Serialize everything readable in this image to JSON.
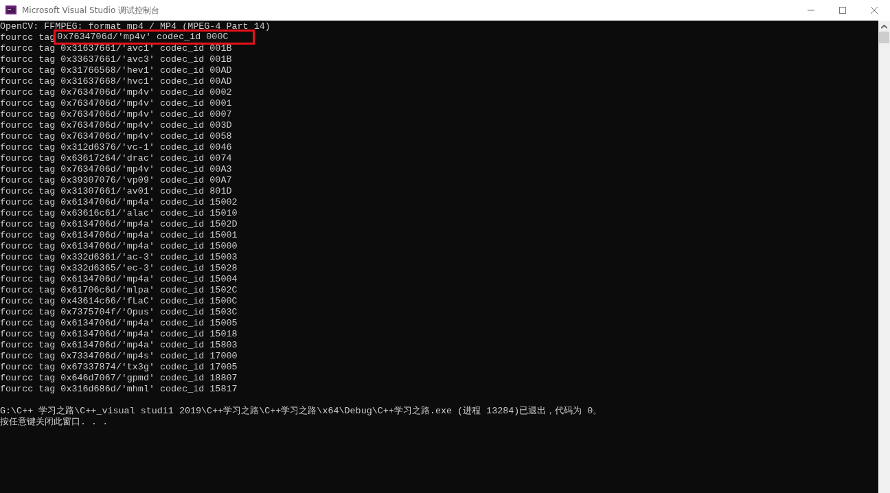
{
  "window": {
    "title": "Microsoft Visual Studio 调试控制台"
  },
  "console": {
    "header": "OpenCV: FFMPEG: format mp4 / MP4 (MPEG-4 Part 14)",
    "lines": [
      {
        "label": "fourcc tag",
        "value": "0x7634706d/'mp4v' codec_id 000C",
        "highlighted": true
      },
      {
        "label": "fourcc tag",
        "value": "0x31637661/'avc1' codec_id 001B",
        "highlighted": false
      },
      {
        "label": "fourcc tag",
        "value": "0x33637661/'avc3' codec_id 001B",
        "highlighted": false
      },
      {
        "label": "fourcc tag",
        "value": "0x31766568/'hev1' codec_id 00AD",
        "highlighted": false
      },
      {
        "label": "fourcc tag",
        "value": "0x31637668/'hvc1' codec_id 00AD",
        "highlighted": false
      },
      {
        "label": "fourcc tag",
        "value": "0x7634706d/'mp4v' codec_id 0002",
        "highlighted": false
      },
      {
        "label": "fourcc tag",
        "value": "0x7634706d/'mp4v' codec_id 0001",
        "highlighted": false
      },
      {
        "label": "fourcc tag",
        "value": "0x7634706d/'mp4v' codec_id 0007",
        "highlighted": false
      },
      {
        "label": "fourcc tag",
        "value": "0x7634706d/'mp4v' codec_id 003D",
        "highlighted": false
      },
      {
        "label": "fourcc tag",
        "value": "0x7634706d/'mp4v' codec_id 0058",
        "highlighted": false
      },
      {
        "label": "fourcc tag",
        "value": "0x312d6376/'vc-1' codec_id 0046",
        "highlighted": false
      },
      {
        "label": "fourcc tag",
        "value": "0x63617264/'drac' codec_id 0074",
        "highlighted": false
      },
      {
        "label": "fourcc tag",
        "value": "0x7634706d/'mp4v' codec_id 00A3",
        "highlighted": false
      },
      {
        "label": "fourcc tag",
        "value": "0x39307076/'vp09' codec_id 00A7",
        "highlighted": false
      },
      {
        "label": "fourcc tag",
        "value": "0x31307661/'av01' codec_id 801D",
        "highlighted": false
      },
      {
        "label": "fourcc tag",
        "value": "0x6134706d/'mp4a' codec_id 15002",
        "highlighted": false
      },
      {
        "label": "fourcc tag",
        "value": "0x63616c61/'alac' codec_id 15010",
        "highlighted": false
      },
      {
        "label": "fourcc tag",
        "value": "0x6134706d/'mp4a' codec_id 1502D",
        "highlighted": false
      },
      {
        "label": "fourcc tag",
        "value": "0x6134706d/'mp4a' codec_id 15001",
        "highlighted": false
      },
      {
        "label": "fourcc tag",
        "value": "0x6134706d/'mp4a' codec_id 15000",
        "highlighted": false
      },
      {
        "label": "fourcc tag",
        "value": "0x332d6361/'ac-3' codec_id 15003",
        "highlighted": false
      },
      {
        "label": "fourcc tag",
        "value": "0x332d6365/'ec-3' codec_id 15028",
        "highlighted": false
      },
      {
        "label": "fourcc tag",
        "value": "0x6134706d/'mp4a' codec_id 15004",
        "highlighted": false
      },
      {
        "label": "fourcc tag",
        "value": "0x61706c6d/'mlpa' codec_id 1502C",
        "highlighted": false
      },
      {
        "label": "fourcc tag",
        "value": "0x43614c66/'fLaC' codec_id 1500C",
        "highlighted": false
      },
      {
        "label": "fourcc tag",
        "value": "0x7375704f/'Opus' codec_id 1503C",
        "highlighted": false
      },
      {
        "label": "fourcc tag",
        "value": "0x6134706d/'mp4a' codec_id 15005",
        "highlighted": false
      },
      {
        "label": "fourcc tag",
        "value": "0x6134706d/'mp4a' codec_id 15018",
        "highlighted": false
      },
      {
        "label": "fourcc tag",
        "value": "0x6134706d/'mp4a' codec_id 15803",
        "highlighted": false
      },
      {
        "label": "fourcc tag",
        "value": "0x7334706d/'mp4s' codec_id 17000",
        "highlighted": false
      },
      {
        "label": "fourcc tag",
        "value": "0x67337874/'tx3g' codec_id 17005",
        "highlighted": false
      },
      {
        "label": "fourcc tag",
        "value": "0x646d7067/'gpmd' codec_id 18807",
        "highlighted": false
      },
      {
        "label": "fourcc tag",
        "value": "0x316d686d/'mhml' codec_id 15817",
        "highlighted": false
      }
    ],
    "exit_lines": [
      "G:\\C++ 学习之路\\C++_visual studi1 2019\\C++学习之路\\C++学习之路\\x64\\Debug\\C++学习之路.exe (进程 13284)已退出，代码为 0。",
      "按任意键关闭此窗口. . ."
    ]
  }
}
